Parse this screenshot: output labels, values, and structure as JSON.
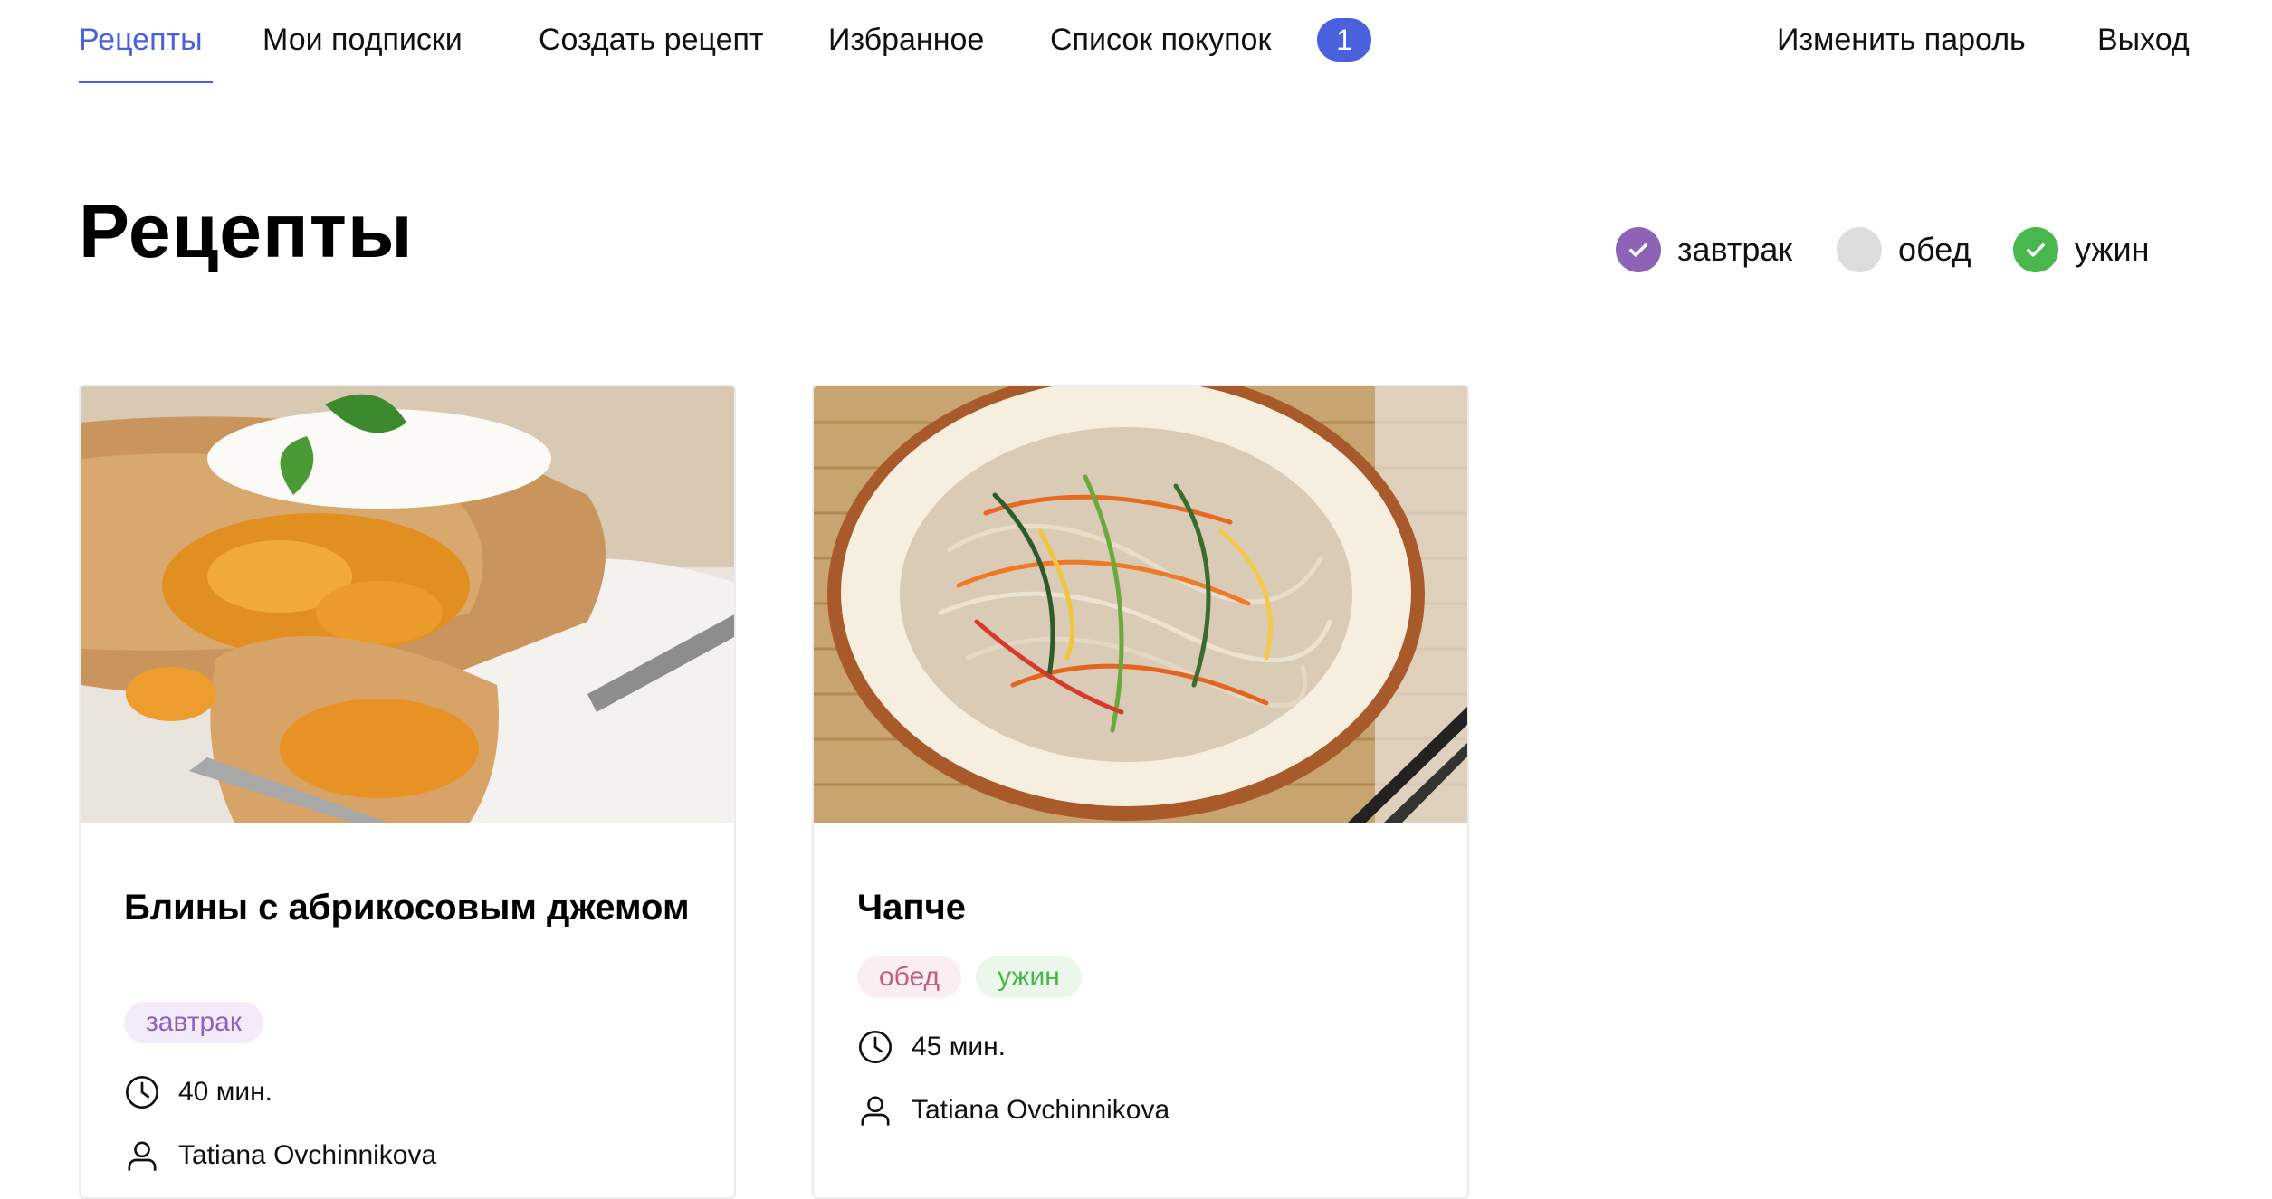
{
  "nav": {
    "recipes": "Рецепты",
    "subscriptions": "Мои подписки",
    "create_recipe": "Создать рецепт",
    "favorites": "Избранное",
    "shopping_list": "Список покупок",
    "shopping_count": "1",
    "change_password": "Изменить пароль",
    "logout": "Выход"
  },
  "page": {
    "title": "Рецепты"
  },
  "filters": [
    {
      "label": "завтрак",
      "checked": true,
      "color": "#8e63b7"
    },
    {
      "label": "обед",
      "checked": false,
      "color": "#d9d9d9"
    },
    {
      "label": "ужин",
      "checked": true,
      "color": "#49b64e"
    }
  ],
  "cards": [
    {
      "title": "Блины с абрикосовым джемом",
      "tags": [
        {
          "label": "завтрак"
        }
      ],
      "time": "40 мин.",
      "author": "Tatiana Ovchinnikova"
    },
    {
      "title": "Чапче",
      "tags": [
        {
          "label": "обед"
        },
        {
          "label": "ужин"
        }
      ],
      "time": "45 мин.",
      "author": "Tatiana Ovchinnikova"
    }
  ],
  "colors": {
    "accent": "#4a61dd",
    "tag_breakfast_bg": "#f3ebfa",
    "tag_breakfast_text": "#8e63b7",
    "tag_lunch_bg": "#fbeef1",
    "tag_lunch_text": "#c35d7f",
    "tag_dinner_bg": "#ecf7ec",
    "tag_dinner_text": "#49b64e"
  },
  "icons": {
    "check": "check-icon",
    "clock": "clock-icon",
    "user": "user-icon"
  }
}
